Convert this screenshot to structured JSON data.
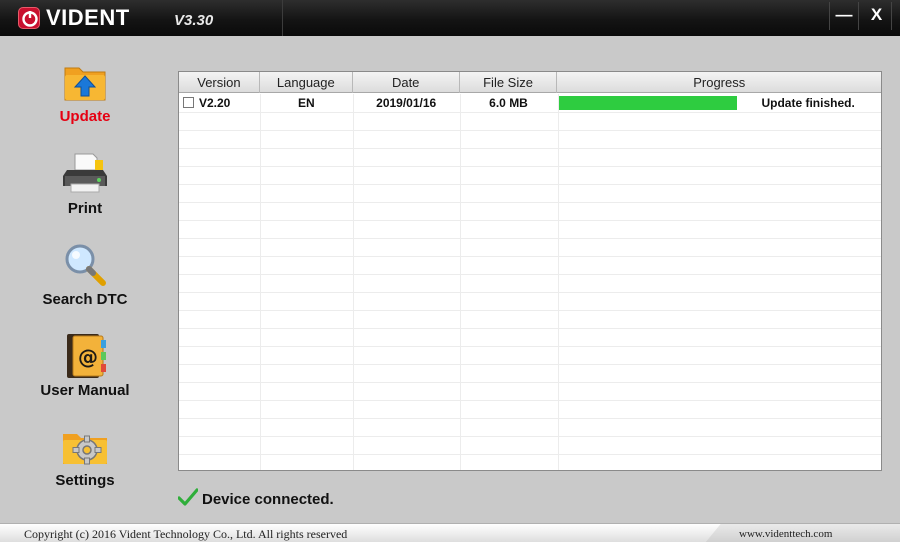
{
  "app": {
    "logo_text": "VIDENT",
    "version": "V3.30",
    "minimize_label": "—",
    "close_label": "X"
  },
  "nav": {
    "items": [
      {
        "label": "Update",
        "icon": "update-folder-icon",
        "active": true
      },
      {
        "label": "Print",
        "icon": "printer-icon",
        "active": false
      },
      {
        "label": "Search DTC",
        "icon": "magnifier-icon",
        "active": false
      },
      {
        "label": "User Manual",
        "icon": "address-book-icon",
        "active": false
      },
      {
        "label": "Settings",
        "icon": "gear-folder-icon",
        "active": false
      }
    ]
  },
  "table": {
    "columns": [
      "Version",
      "Language",
      "Date",
      "File Size",
      "Progress"
    ],
    "rows": [
      {
        "version": "V2.20",
        "language": "EN",
        "date": "2019/01/16",
        "file_size": "6.0 MB",
        "progress": 1.0,
        "progress_text": "Update finished."
      }
    ]
  },
  "status": {
    "text": "Device connected.",
    "icon": "checkmark-icon"
  },
  "footer": {
    "copyright": "Copyright (c) 2016 Vident Technology Co., Ltd. All rights reserved",
    "website": "www.videnttech.com"
  },
  "colors": {
    "accent": "#e60012",
    "progress": "#2ecc40",
    "titlebar": "#141414"
  }
}
